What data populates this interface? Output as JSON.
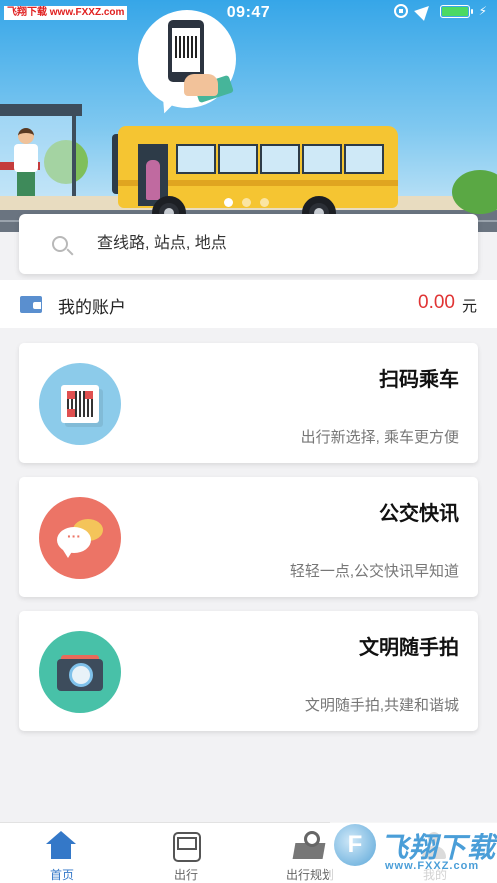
{
  "status_bar": {
    "watermark": "飞翔下载 www.FXXZ.com",
    "time": "09:47",
    "bolt": "⚡"
  },
  "banner": {
    "slide_count": 3,
    "active_slide": 1
  },
  "search": {
    "placeholder": "查线路, 站点, 地点"
  },
  "account": {
    "label": "我的账户",
    "amount": "0.00",
    "unit": "元",
    "amount_color": "#e03434"
  },
  "services": [
    {
      "title": "扫码乘车",
      "desc": "出行新选择, 乘车更方便",
      "icon": "qr-code-icon",
      "color": "#8ccbea"
    },
    {
      "title": "公交快讯",
      "desc": "轻轻一点,公交快讯早知道",
      "icon": "chat-bubble-icon",
      "color": "#ec7466",
      "glyph": "···"
    },
    {
      "title": "文明随手拍",
      "desc": "文明随手拍,共建和谐城",
      "icon": "camera-icon",
      "color": "#48c1a8"
    }
  ],
  "tabbar": {
    "accent": "#3478c8",
    "tabs": [
      {
        "label": "首页",
        "icon": "home-icon",
        "active": true
      },
      {
        "label": "出行",
        "icon": "bus-icon",
        "active": false
      },
      {
        "label": "出行规划",
        "icon": "map-pin-icon",
        "active": false
      },
      {
        "label": "我的",
        "icon": "user-icon",
        "active": false
      }
    ]
  },
  "overlay_logo": {
    "glyph": "F",
    "text": "飞翔下载",
    "url": "www.FXXZ.com"
  }
}
